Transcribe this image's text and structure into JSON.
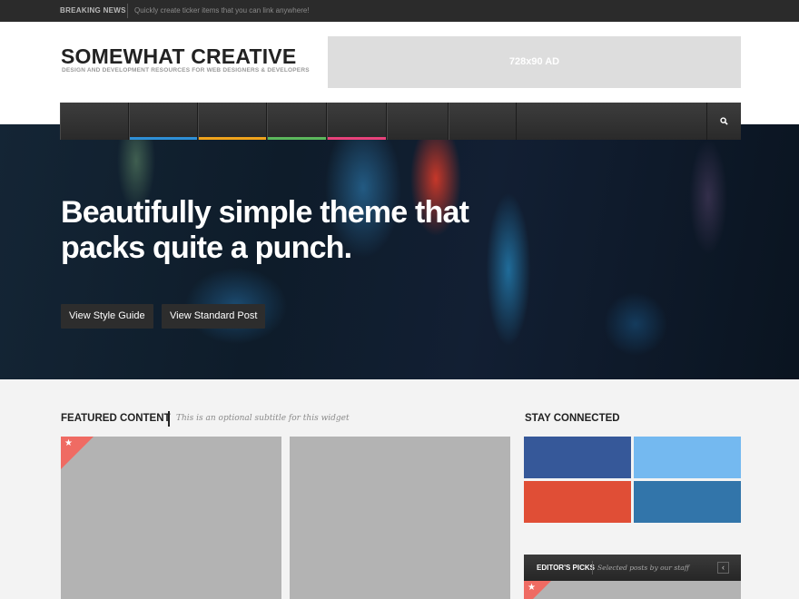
{
  "ticker": {
    "label": "BREAKING NEWS",
    "text": "Quickly create ticker items that you can link anywhere!"
  },
  "header": {
    "title": "SOMEWHAT CREATIVE",
    "tagline": "DESIGN AND DEVELOPMENT RESOURCES FOR WEB DESIGNERS & DEVELOPERS",
    "ad_label": "728x90 AD"
  },
  "nav": {
    "accent_colors": [
      "",
      "#2e8fd6",
      "#f0a31c",
      "#5cb85c",
      "#e8427a",
      "",
      ""
    ],
    "search_icon": "search-icon"
  },
  "hero": {
    "title": "Beautifully simple theme that packs quite a punch.",
    "buttons": [
      "View Style Guide",
      "View Standard Post"
    ]
  },
  "featured": {
    "title": "FEATURED CONTENT",
    "subtitle": "This is an optional subtitle for this widget",
    "corner_color": "#ef6b63"
  },
  "sidebar": {
    "stay_title": "STAY CONNECTED",
    "social_colors": [
      "#365899",
      "#74b9f0",
      "#e04e36",
      "#3275aa"
    ],
    "editors_picks": {
      "title": "EDITOR'S PICKS",
      "subtitle": "Selected posts by our staff",
      "arrow": "‹"
    }
  }
}
